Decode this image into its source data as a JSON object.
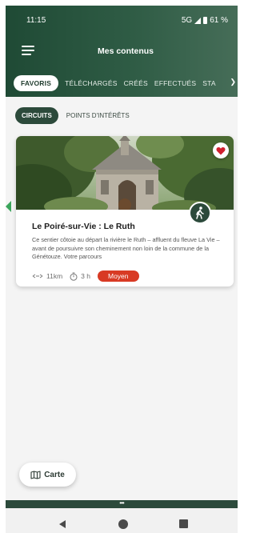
{
  "status_bar": {
    "time": "11:15",
    "network": "5G",
    "battery": "61 %"
  },
  "header": {
    "title": "Mes contenus"
  },
  "tabs": [
    {
      "label": "FAVORIS",
      "active": true
    },
    {
      "label": "TÉLÉCHARGÉS",
      "active": false
    },
    {
      "label": "CRÉÉS",
      "active": false
    },
    {
      "label": "EFFECTUÉS",
      "active": false
    },
    {
      "label": "STA",
      "active": false
    }
  ],
  "subtabs": [
    {
      "label": "CIRCUITS",
      "active": true
    },
    {
      "label": "POINTS D'INTÉRÊTS",
      "active": false
    }
  ],
  "card": {
    "title": "Le Poiré-sur-Vie : Le Ruth",
    "description": "Ce sentier côtoie au départ la rivière le Ruth – affluent du fleuve La Vie – avant de poursuivre son cheminement non loin de la commune de la Génétouze. Votre parcours",
    "distance": "11km",
    "duration": "3 h",
    "difficulty": "Moyen",
    "favorite": true
  },
  "map_button": {
    "label": "Carte"
  },
  "colors": {
    "primary": "#2c4a3b",
    "difficulty": "#d83a24",
    "favorite": "#d0202e"
  },
  "icons": [
    "menu-icon",
    "heart-icon",
    "hiker-icon",
    "distance-icon",
    "timer-icon",
    "map-icon",
    "back-icon",
    "home-icon",
    "recent-apps-icon"
  ]
}
